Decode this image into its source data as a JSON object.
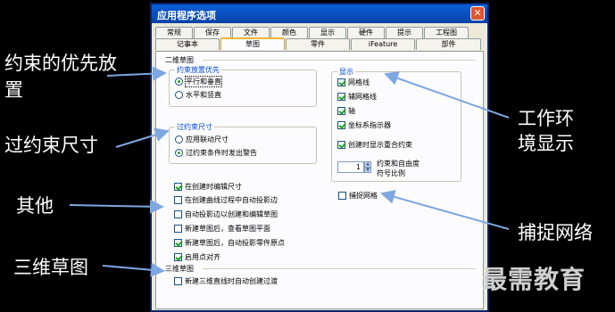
{
  "dialog": {
    "title": "应用程序选项",
    "close_glyph": "✕",
    "tabs_back": [
      "常规",
      "保存",
      "文件",
      "颜色",
      "显示",
      "硬件",
      "提示",
      "工程图"
    ],
    "tabs_front": [
      "记事本",
      "草图",
      "零件",
      "iFeature",
      "部件"
    ],
    "active_tab": "草图",
    "panel_heading": "二维草图",
    "constraint_priority": {
      "title": "约束放置优先",
      "options": [
        {
          "label": "平行和垂直",
          "selected": true
        },
        {
          "label": "水平和竖直",
          "selected": false
        }
      ]
    },
    "over_constraint": {
      "title": "过约束尺寸",
      "options": [
        {
          "label": "应用联动尺寸",
          "selected": false
        },
        {
          "label": "过约束条件时发出警告",
          "selected": true
        }
      ]
    },
    "display": {
      "title": "显示",
      "items": [
        {
          "label": "网格线",
          "checked": true
        },
        {
          "label": "辅网格线",
          "checked": true
        },
        {
          "label": "轴",
          "checked": true
        },
        {
          "label": "坐标系指示器",
          "checked": true
        },
        {
          "label": "创建时显示重合约束",
          "checked": true
        }
      ],
      "spin_value": "1",
      "spin_label_line1": "约束和自由度",
      "spin_label_line2": "符号比例"
    },
    "snap_grid": {
      "label": "捕捉网格",
      "checked": false
    },
    "misc_options": [
      {
        "label": "在创建时编辑尺寸",
        "checked": true
      },
      {
        "label": "在创建曲线过程中自动投影边",
        "checked": false
      },
      {
        "label": "自动投影边以创建和编辑草图",
        "checked": false
      },
      {
        "label": "新建草图后，查看草图平面",
        "checked": false
      },
      {
        "label": "新建草图后，自动投影零件原点",
        "checked": true
      },
      {
        "label": "启用点对齐",
        "checked": true
      }
    ],
    "sketch3d_heading": "三维草图",
    "sketch3d_options": [
      {
        "label": "新建三维直线时自动创建过渡",
        "checked": false
      }
    ]
  },
  "annotations": {
    "constraint_priority_line1": "约束的优先放",
    "constraint_priority_line2": "置",
    "over_constraint": "过约束尺寸",
    "other": "其他",
    "sketch3d": "三维草图",
    "environment_line1": "工作环",
    "environment_line2": "境显示",
    "snap_grid": "捕捉网络"
  },
  "watermark": "最需教育",
  "colors": {
    "title_bar": "#0842a8",
    "group_title": "#0046d5",
    "check_mark": "#21a121",
    "background": "#000000"
  }
}
